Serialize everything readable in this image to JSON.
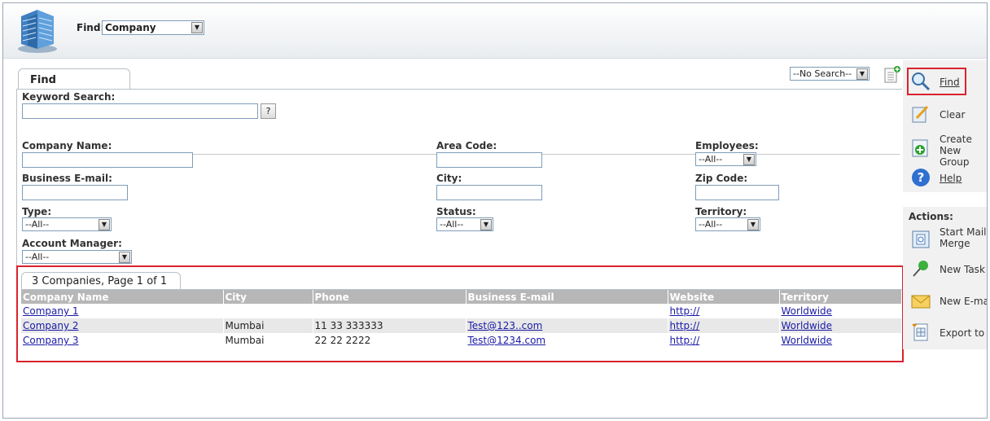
{
  "header": {
    "find_label": "Find:",
    "find_value": "Company"
  },
  "search": {
    "tab": "Find",
    "no_search": "--No Search--",
    "keyword_label": "Keyword Search:",
    "keyword_value": "",
    "help_q": "?",
    "fields": {
      "company_name": {
        "label": "Company Name:",
        "value": ""
      },
      "business_email": {
        "label": "Business E-mail:",
        "value": ""
      },
      "type": {
        "label": "Type:",
        "value": "--All--"
      },
      "account_manager": {
        "label": "Account Manager:",
        "value": "--All--"
      },
      "area_code": {
        "label": "Area Code:",
        "value": ""
      },
      "city": {
        "label": "City:",
        "value": ""
      },
      "status": {
        "label": "Status:",
        "value": "--All--"
      },
      "employees": {
        "label": "Employees:",
        "value": "--All--"
      },
      "zip_code": {
        "label": "Zip Code:",
        "value": ""
      },
      "territory": {
        "label": "Territory:",
        "value": "--All--"
      }
    }
  },
  "results": {
    "title": "3 Companies, Page 1 of 1",
    "columns": [
      "Company Name",
      "City",
      "Phone",
      "Business E-mail",
      "Website",
      "Territory"
    ],
    "rows": [
      {
        "company": "Company 1",
        "city": "",
        "phone": "",
        "email": "",
        "website": "http://",
        "territory": "Worldwide"
      },
      {
        "company": "Company 2",
        "city": "Mumbai",
        "phone": "11 33 333333",
        "email": "Test@123..com",
        "website": "http://",
        "territory": "Worldwide"
      },
      {
        "company": "Company 3",
        "city": "Mumbai",
        "phone": "22 22 2222",
        "email": "Test@1234.com",
        "website": "http://",
        "territory": "Worldwide"
      }
    ]
  },
  "sidebar": {
    "find": "Find",
    "clear": "Clear",
    "create_group": "Create New Group",
    "help": "Help",
    "actions_label": "Actions:",
    "mail_merge": "Start Mail Merge",
    "new_task": "New Task",
    "new_email": "New E-mail",
    "export": "Export to Fil"
  },
  "colors": {
    "highlight": "#d9232d",
    "link": "#1a1aa6",
    "header_row": "#b7b7b7"
  }
}
